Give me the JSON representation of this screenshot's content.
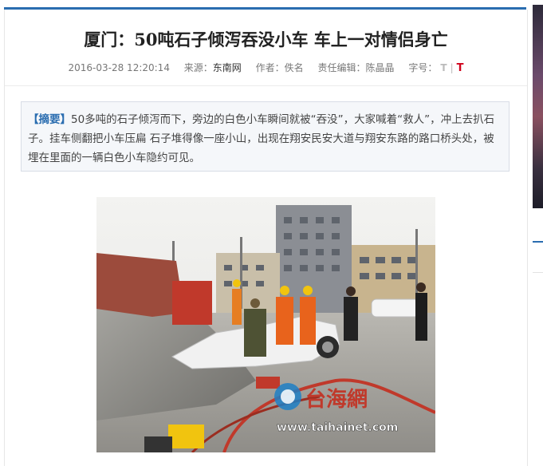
{
  "article": {
    "title": "厦门：50吨石子倾泻吞没小车  车上一对情侣身亡",
    "meta": {
      "datetime": "2016-03-28 12:20:14",
      "source_label": "来源：",
      "source": "东南网",
      "author_label": "作者：",
      "author": "佚名",
      "editor_label": "责任编辑：",
      "editor": "陈晶晶",
      "fontsize_label": "字号：",
      "fontsize_small": "T",
      "fontsize_sep": "|",
      "fontsize_large": "T"
    },
    "summary": {
      "tag": "【摘要】",
      "text": "50多吨的石子倾泻而下，旁边的白色小车瞬间就被“吞没”，大家喊着“救人”，冲上去扒石子。挂车侧翻把小车压扁      石子堆得像一座小山，出现在翔安民安大道与翔安东路的路口桥头处，被埋在里面的一辆白色小车隐约可见。"
    },
    "photo": {
      "watermark_cn": "台海網",
      "watermark_url": "www.taihainet.com"
    }
  },
  "colors": {
    "accent": "#2a6db0",
    "summary_bg": "#f5f7fa",
    "fontsize_large": "#d0021b"
  }
}
